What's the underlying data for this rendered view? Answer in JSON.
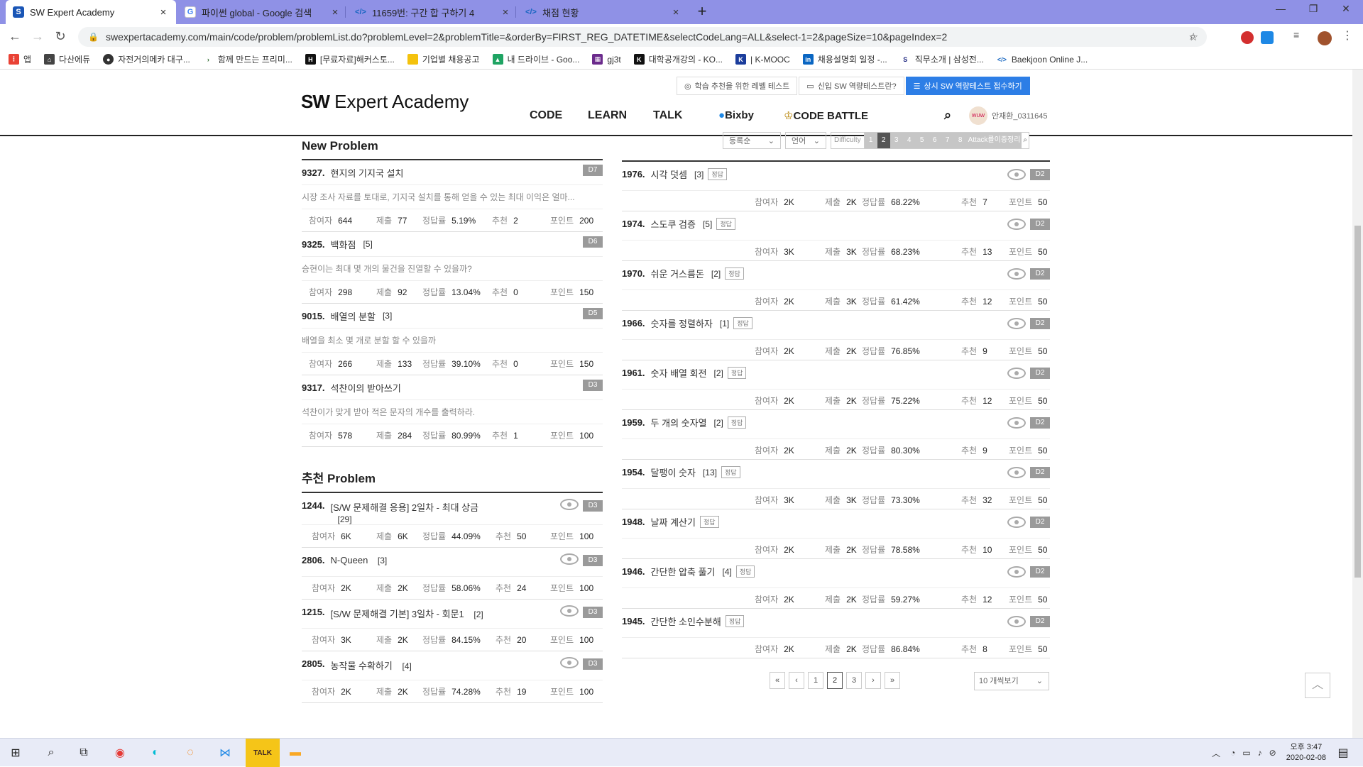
{
  "browser": {
    "tabs": [
      {
        "title": "SW Expert Academy",
        "active": true
      },
      {
        "title": "파이썬 global - Google 검색",
        "active": false
      },
      {
        "title": "11659번: 구간 합 구하기 4",
        "active": false
      },
      {
        "title": "채점 현황",
        "active": false
      }
    ],
    "url": "swexpertacademy.com/main/code/problem/problemList.do?problemLevel=2&problemTitle=&orderBy=FIRST_REG_DATETIME&selectCodeLang=ALL&select-1=2&pageSize=10&pageIndex=2",
    "bookmarks": [
      "앱",
      "다산에듀",
      "자전거의메카 대구...",
      "함께 만드는 프리미...",
      "[무료자료]해커스토...",
      "기업별 채용공고",
      "내 드라이브 - Goo...",
      "gj3t",
      "대학공개강의 - KO...",
      "| K-MOOC",
      "채용설명회 일정 -...",
      "직무소개 | 삼성전...",
      "Baekjoon Online J..."
    ],
    "bookmark_colors": [
      "#4285f4",
      "#444",
      "#333",
      "#2d6a2d",
      "#111",
      "#f4c20d",
      "#1fa463",
      "#6b2b8c",
      "#111",
      "#1b3d9c",
      "#0a66c2",
      "#1a237e",
      "#1565c0"
    ]
  },
  "site": {
    "logo_bold": "SW",
    "logo_rest": " Expert Academy",
    "top_buttons": [
      "학습 추천을 위한 레벨 테스트",
      "신입 SW 역량테스트란?",
      "상시 SW 역량테스트 접수하기"
    ],
    "nav": [
      "CODE",
      "LEARN",
      "TALK",
      "Bixby",
      "CODE BATTLE"
    ],
    "user": "안재환_0311645",
    "avatar_text": "WUW",
    "filters": {
      "order": "등록순",
      "lang": "언어",
      "difficulty_label": "Difficulty",
      "levels": [
        "1",
        "2",
        "3",
        "4",
        "5",
        "6",
        "7",
        "8"
      ],
      "selected_level": "2",
      "extra": "Attack률이증정리"
    }
  },
  "stat_labels": {
    "participants": "참여자",
    "submissions": "제출",
    "accuracy": "정답률",
    "recommend": "추천",
    "points": "포인트"
  },
  "new_problem": {
    "title": "New Problem",
    "items": [
      {
        "num": "9327.",
        "title": "현지의 기지국 설치",
        "count": "",
        "badge": "D7",
        "desc": "시장 조사 자료를 토대로, 기지국 설치를 통해 얻을 수 있는 최대 이익은 얼마...",
        "part": "644",
        "sub": "77",
        "acc": "5.19%",
        "rec": "2",
        "pts": "200"
      },
      {
        "num": "9325.",
        "title": "백화점",
        "count": "[5]",
        "badge": "D6",
        "desc": "승현이는 최대 몇 개의 물건을 진열할 수 있을까?",
        "part": "298",
        "sub": "92",
        "acc": "13.04%",
        "rec": "0",
        "pts": "150"
      },
      {
        "num": "9015.",
        "title": "배열의 분할",
        "count": "[3]",
        "badge": "D5",
        "desc": "배열을 최소 몇 개로 분할 할 수 있을까",
        "part": "266",
        "sub": "133",
        "acc": "39.10%",
        "rec": "0",
        "pts": "150"
      },
      {
        "num": "9317.",
        "title": "석찬이의 받아쓰기",
        "count": "",
        "badge": "D3",
        "desc": "석찬이가 맞게 받아 적은 문자의 개수를 출력하라.",
        "part": "578",
        "sub": "284",
        "acc": "80.99%",
        "rec": "1",
        "pts": "100"
      }
    ]
  },
  "recommend_problem": {
    "title": "추천 Problem",
    "items": [
      {
        "num": "1244.",
        "title": "[S/W 문제해결 응용] 2일차 - 최대 상금",
        "count": "[29]",
        "badge": "D3",
        "part": "6K",
        "sub": "6K",
        "acc": "44.09%",
        "rec": "50",
        "pts": "100"
      },
      {
        "num": "2806.",
        "title": "N-Queen",
        "count": "[3]",
        "badge": "D3",
        "part": "2K",
        "sub": "2K",
        "acc": "58.06%",
        "rec": "24",
        "pts": "100"
      },
      {
        "num": "1215.",
        "title": "[S/W 문제해결 기본] 3일차 - 회문1",
        "count": "[2]",
        "badge": "D3",
        "part": "3K",
        "sub": "2K",
        "acc": "84.15%",
        "rec": "20",
        "pts": "100"
      },
      {
        "num": "2805.",
        "title": "농작물 수확하기",
        "count": "[4]",
        "badge": "D3",
        "part": "2K",
        "sub": "2K",
        "acc": "74.28%",
        "rec": "19",
        "pts": "100"
      }
    ]
  },
  "problem_list": {
    "solved_label": "정답",
    "items": [
      {
        "num": "1976.",
        "title": "시각 덧셈",
        "count": "[3]",
        "badge": "D2",
        "part": "2K",
        "sub": "2K",
        "acc": "68.22%",
        "rec": "7",
        "pts": "50"
      },
      {
        "num": "1974.",
        "title": "스도쿠 검증",
        "count": "[5]",
        "badge": "D2",
        "part": "3K",
        "sub": "3K",
        "acc": "68.23%",
        "rec": "13",
        "pts": "50"
      },
      {
        "num": "1970.",
        "title": "쉬운 거스름돈",
        "count": "[2]",
        "badge": "D2",
        "part": "2K",
        "sub": "3K",
        "acc": "61.42%",
        "rec": "12",
        "pts": "50"
      },
      {
        "num": "1966.",
        "title": "숫자를 정렬하자",
        "count": "[1]",
        "badge": "D2",
        "part": "2K",
        "sub": "2K",
        "acc": "76.85%",
        "rec": "9",
        "pts": "50"
      },
      {
        "num": "1961.",
        "title": "숫자 배열 회전",
        "count": "[2]",
        "badge": "D2",
        "part": "2K",
        "sub": "2K",
        "acc": "75.22%",
        "rec": "12",
        "pts": "50"
      },
      {
        "num": "1959.",
        "title": "두 개의 숫자열",
        "count": "[2]",
        "badge": "D2",
        "part": "2K",
        "sub": "2K",
        "acc": "80.30%",
        "rec": "9",
        "pts": "50"
      },
      {
        "num": "1954.",
        "title": "달팽이 숫자",
        "count": "[13]",
        "badge": "D2",
        "part": "3K",
        "sub": "3K",
        "acc": "73.30%",
        "rec": "32",
        "pts": "50"
      },
      {
        "num": "1948.",
        "title": "날짜 계산기",
        "count": "",
        "badge": "D2",
        "part": "2K",
        "sub": "2K",
        "acc": "78.58%",
        "rec": "10",
        "pts": "50"
      },
      {
        "num": "1946.",
        "title": "간단한 압축 풀기",
        "count": "[4]",
        "badge": "D2",
        "part": "2K",
        "sub": "2K",
        "acc": "59.27%",
        "rec": "12",
        "pts": "50"
      },
      {
        "num": "1945.",
        "title": "간단한 소인수분해",
        "count": "",
        "badge": "D2",
        "part": "2K",
        "sub": "2K",
        "acc": "86.84%",
        "rec": "8",
        "pts": "50"
      }
    ]
  },
  "pagination": {
    "first": "«",
    "prev": "‹",
    "pages": [
      "1",
      "2",
      "3"
    ],
    "current": "2",
    "next": "›",
    "last": "»",
    "page_size": "10 개씩보기"
  },
  "taskbar": {
    "time": "오후 3:47",
    "date": "2020-02-08"
  }
}
